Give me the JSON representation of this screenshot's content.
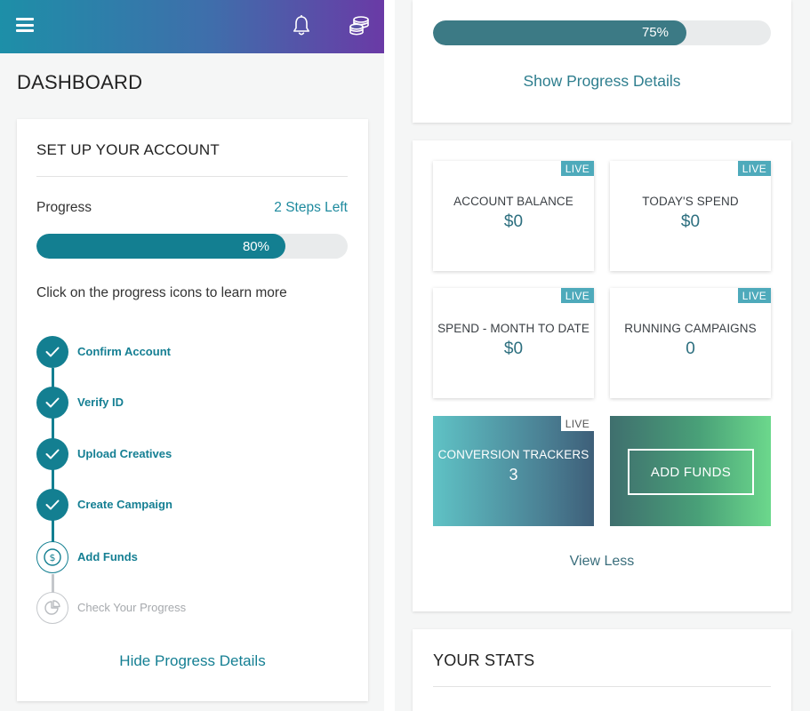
{
  "left_panel": {
    "header": {
      "menu_icon": "hamburger-menu-icon",
      "notification_icon": "bell-icon",
      "funds_icon": "coin-stack-icon"
    },
    "page_title": "DASHBOARD",
    "setup_card": {
      "title": "SET UP YOUR ACCOUNT",
      "progress_label": "Progress",
      "steps_left": "2 Steps Left",
      "progress_percent": 80,
      "progress_text": "80%",
      "hint": "Click on the progress icons to learn more",
      "steps": [
        {
          "label": "Confirm Account",
          "status": "done",
          "icon": "check-icon"
        },
        {
          "label": "Verify ID",
          "status": "done",
          "icon": "check-icon"
        },
        {
          "label": "Upload Creatives",
          "status": "done",
          "icon": "check-icon"
        },
        {
          "label": "Create Campaign",
          "status": "done",
          "icon": "check-icon"
        },
        {
          "label": "Add Funds",
          "status": "current",
          "icon": "dollar-icon"
        },
        {
          "label": "Check Your Progress",
          "status": "pending",
          "icon": "pie-chart-icon"
        }
      ],
      "hide_link": "Hide Progress Details"
    }
  },
  "right_panel": {
    "progress_card": {
      "progress_percent": 75,
      "progress_text": "75%",
      "show_link": "Show Progress Details"
    },
    "tiles": [
      {
        "label": "ACCOUNT BALANCE",
        "value": "$0",
        "badge": "LIVE"
      },
      {
        "label": "TODAY'S SPEND",
        "value": "$0",
        "badge": "LIVE"
      },
      {
        "label": "SPEND - MONTH TO DATE",
        "value": "$0",
        "badge": "LIVE"
      },
      {
        "label": "RUNNING CAMPAIGNS",
        "value": "0",
        "badge": "LIVE"
      },
      {
        "label": "CONVERSION TRACKERS",
        "value": "3",
        "badge": "LIVE"
      }
    ],
    "add_funds_label": "ADD FUNDS",
    "view_less": "View Less",
    "stats_title": "YOUR STATS"
  },
  "colors": {
    "primary_teal": "#137f91",
    "link_teal": "#157f93",
    "live_badge": "#4eaabb",
    "header_gradient_start": "#1d8fa8",
    "header_gradient_end": "#6a3aa6"
  }
}
